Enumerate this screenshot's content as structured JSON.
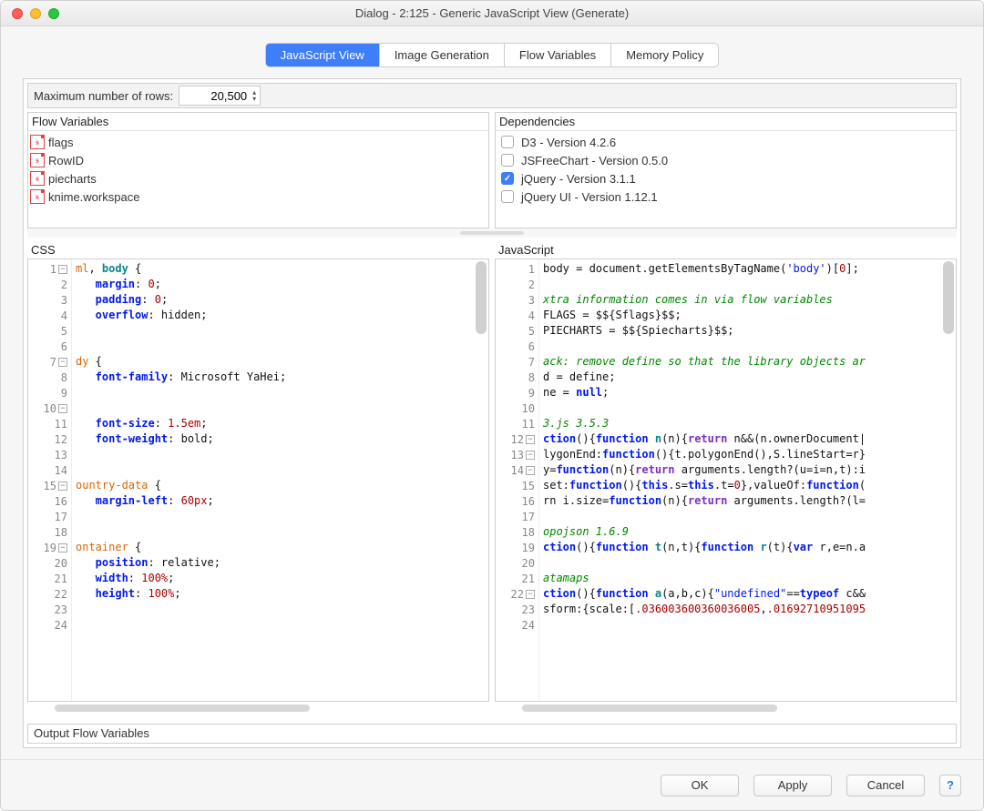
{
  "window": {
    "title": "Dialog - 2:125 - Generic JavaScript View (Generate)"
  },
  "tabs": {
    "items": [
      "JavaScript View",
      "Image Generation",
      "Flow Variables",
      "Memory Policy"
    ],
    "active": 0
  },
  "maxRows": {
    "label": "Maximum number of rows:",
    "value": "20,500"
  },
  "sections": {
    "flowVars": "Flow Variables",
    "deps": "Dependencies",
    "css": "CSS",
    "js": "JavaScript",
    "output": "Output Flow Variables"
  },
  "flowVariables": [
    {
      "label": "flags"
    },
    {
      "label": "RowID"
    },
    {
      "label": "piecharts"
    },
    {
      "label": "knime.workspace"
    }
  ],
  "dependencies": [
    {
      "label": "D3 - Version 4.2.6",
      "checked": false
    },
    {
      "label": "JSFreeChart - Version 0.5.0",
      "checked": false
    },
    {
      "label": "jQuery - Version 3.1.1",
      "checked": true
    },
    {
      "label": "jQuery UI - Version 1.12.1",
      "checked": false
    }
  ],
  "css": {
    "lines": [
      "1",
      "2",
      "3",
      "4",
      "5",
      "6",
      "7",
      "8",
      "9",
      "10",
      "11",
      "12",
      "13",
      "14",
      "15",
      "16",
      "17",
      "18",
      "19",
      "20",
      "21",
      "22",
      "23",
      "24"
    ],
    "text": {
      "l1a": "ml",
      "l1b": ", ",
      "l1c": "body",
      "l1d": " {",
      "l2a": "   margin",
      "l2b": ": ",
      "l2c": "0",
      "l2d": ";",
      "l3a": "   padding",
      "l3b": ": ",
      "l3c": "0",
      "l3d": ";",
      "l4a": "   overflow",
      "l4b": ": hidden;",
      "l7a": "dy",
      "l7b": " {",
      "l8a": "   font-family",
      "l8b": ": Microsoft YaHei;",
      "l10": "",
      "l11a": "   font-size",
      "l11b": ": ",
      "l11c": "1.5em",
      "l11d": ";",
      "l12a": "   font-weight",
      "l12b": ": bold;",
      "l15a": "ountry-data",
      "l15b": " {",
      "l16a": "   margin-left",
      "l16b": ": ",
      "l16c": "60px",
      "l16d": ";",
      "l19a": "ontainer",
      "l19b": " {",
      "l20a": "   position",
      "l20b": ": relative;",
      "l21a": "   width",
      "l21b": ": ",
      "l21c": "100%",
      "l21d": ";",
      "l22a": "   height",
      "l22b": ": ",
      "l22c": "100%",
      "l22d": ";"
    }
  },
  "js": {
    "lines": [
      "1",
      "2",
      "3",
      "4",
      "5",
      "6",
      "7",
      "8",
      "9",
      "10",
      "11",
      "12",
      "13",
      "14",
      "15",
      "16",
      "17",
      "18",
      "19",
      "20",
      "21",
      "22",
      "23",
      "24"
    ],
    "text": {
      "l1a": "body = document.getElementsByTagName(",
      "l1b": "'body'",
      "l1c": ")[",
      "l1d": "0",
      "l1e": "];",
      "l3": "xtra information comes in via flow variables",
      "l4a": "FLAGS = $${Sflags}$$",
      "l4b": ";",
      "l5a": "PIECHARTS = $${Spiecharts}$$",
      "l5b": ";",
      "l7": "ack: remove define so that the library objects ar",
      "l8": "d = define;",
      "l9a": "ne = ",
      "l9b": "null",
      "l9c": ";",
      "l11": "3.js 3.5.3",
      "l12a": "ction",
      "l12b": "(){",
      "l12c": "function",
      "l12d": " n",
      "l12e": "(n){",
      "l12f": "return",
      "l12g": " n&&(n.ownerDocument|",
      "l13a": "lygonEnd:",
      "l13b": "function",
      "l13c": "(){",
      "l13d": "t.polygonEnd(),S.lineStart=r}",
      "l14a": "y=",
      "l14b": "function",
      "l14c": "(n){",
      "l14d": "return",
      "l14e": " arguments.length?(u=i=n,t):i",
      "l15a": "set:",
      "l15b": "function",
      "l15c": "(){",
      "l15d": "this",
      "l15e": ".s=",
      "l15f": "this",
      "l15g": ".t=",
      "l15h": "0",
      "l15i": "},valueOf:",
      "l15j": "function",
      "l15k": "(",
      "l16a": "rn i.size=",
      "l16b": "function",
      "l16c": "(n){",
      "l16d": "return",
      "l16e": " arguments.length?(l=",
      "l18": "opojson 1.6.9",
      "l19a": "ction",
      "l19b": "(){",
      "l19c": "function",
      "l19d": " t",
      "l19e": "(n,t){",
      "l19f": "function",
      "l19g": " r",
      "l19h": "(t){",
      "l19i": "var",
      "l19j": " r,e=n.a",
      "l21": "atamaps",
      "l22a": "ction",
      "l22b": "(){",
      "l22c": "function",
      "l22d": " a",
      "l22e": "(a,b,c){",
      "l22f": "\"undefined\"",
      "l22g": "==",
      "l22h": "typeof",
      "l22i": " c&&",
      "l23a": "sform:{scale:[",
      "l23b": ".036003600360036005",
      "l23c": ",",
      "l23d": ".01692710951095"
    }
  },
  "footer": {
    "ok": "OK",
    "apply": "Apply",
    "cancel": "Cancel"
  }
}
